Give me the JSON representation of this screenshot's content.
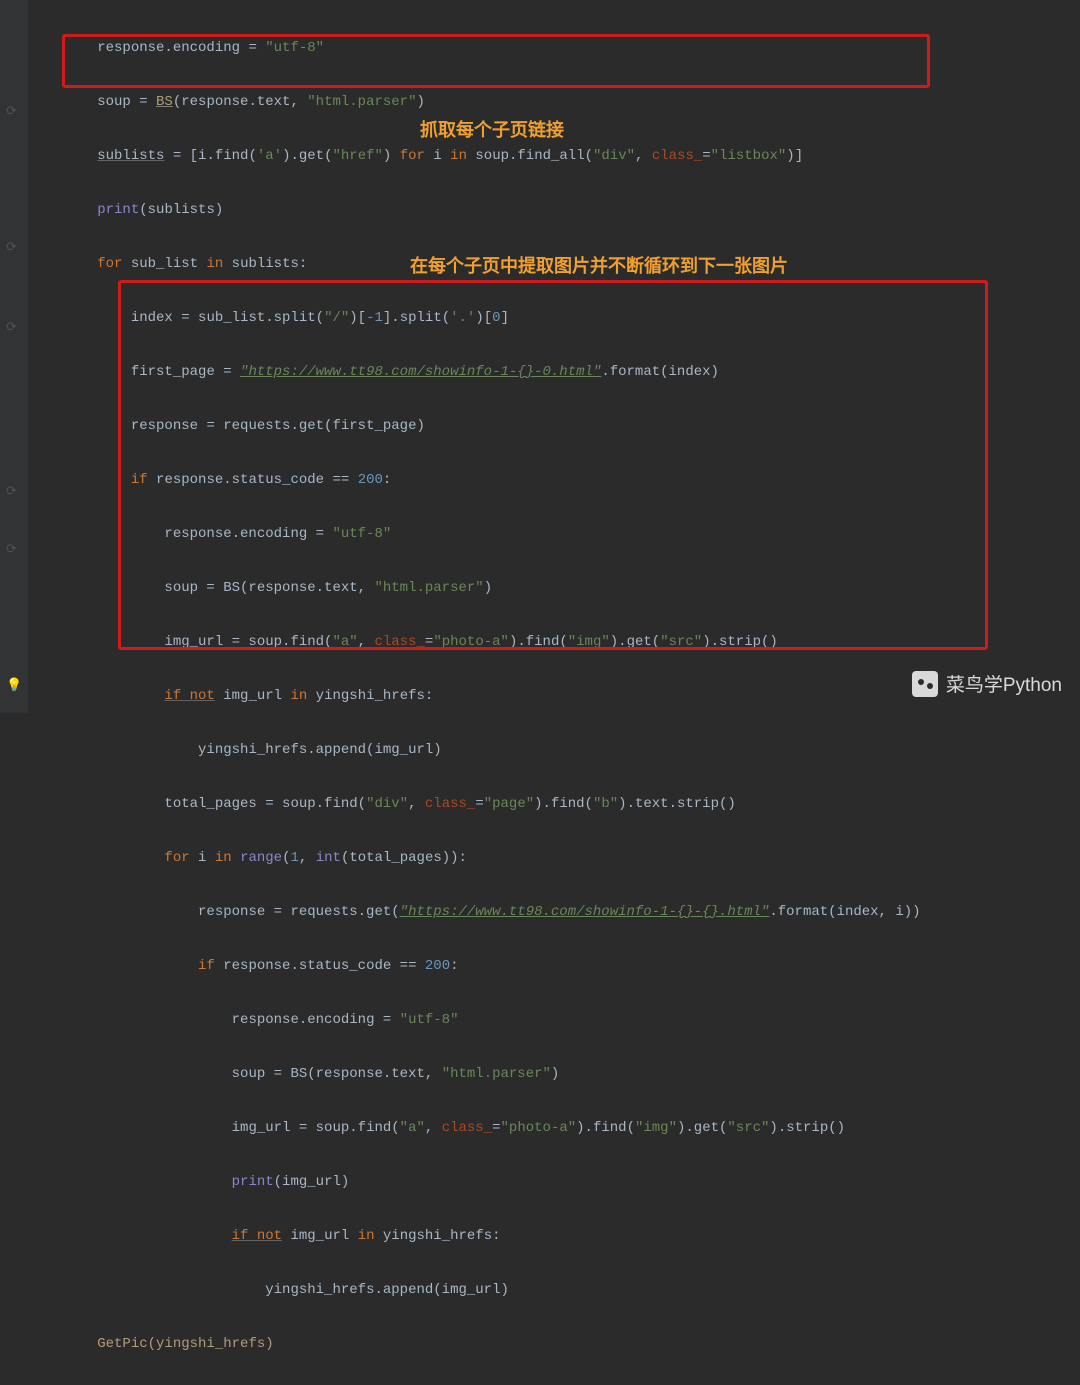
{
  "annotations": {
    "box1_label": "抓取每个子页链接",
    "box2_label": "在每个子页中提取图片并不断循环到下一张图片"
  },
  "watermark": "菜鸟学Python",
  "code": {
    "l01_a": "response.encoding = ",
    "l01_s": "\"utf-8\"",
    "l02_a": "soup = ",
    "l02_b": "BS",
    "l02_c": "(response.text, ",
    "l02_s": "\"html.parser\"",
    "l02_d": ")",
    "l03_a": "sublists",
    "l03_b": " = [i.find(",
    "l03_s1": "'a'",
    "l03_c": ").get(",
    "l03_s2": "\"href\"",
    "l03_d": ") ",
    "l03_kw1": "for",
    "l03_e": " i ",
    "l03_kw2": "in",
    "l03_f": " soup.find_all(",
    "l03_s3": "\"div\"",
    "l03_g": ", ",
    "l03_kwarg": "class_",
    "l03_h": "=",
    "l03_s4": "\"listbox\"",
    "l03_i": ")]",
    "l04_a": "print",
    "l04_b": "(sublists)",
    "l05_kw1": "for",
    "l05_a": " sub_list ",
    "l05_kw2": "in",
    "l05_b": " sublists:",
    "l06_a": "index = sub_list.split(",
    "l06_s1": "\"/\"",
    "l06_b": ")[",
    "l06_n": "-1",
    "l06_c": "].split(",
    "l06_s2": "'.'",
    "l06_d": ")[",
    "l06_n2": "0",
    "l06_e": "]",
    "l07_a": "first_page = ",
    "l07_s": "\"https://www.tt98.com/showinfo-1-{}-0.html\"",
    "l07_b": ".format(index)",
    "l08_a": "response = requests.get(first_page)",
    "l09_kw": "if",
    "l09_a": " response.status_code == ",
    "l09_n": "200",
    "l09_b": ":",
    "l10_a": "response.encoding = ",
    "l10_s": "\"utf-8\"",
    "l11_a": "soup = BS(response.text, ",
    "l11_s": "\"html.parser\"",
    "l11_b": ")",
    "l12_a": "img_url = soup.find(",
    "l12_s1": "\"a\"",
    "l12_b": ", ",
    "l12_kwarg": "class_",
    "l12_c": "=",
    "l12_s2": "\"photo-a\"",
    "l12_d": ").find(",
    "l12_s3": "\"img\"",
    "l12_e": ").get(",
    "l12_s4": "\"src\"",
    "l12_f": ").strip()",
    "l13_kw1": "if not",
    "l13_a": " img_url ",
    "l13_kw2": "in",
    "l13_b": " yingshi_hrefs:",
    "l14_a": "yingshi_hrefs.append(img_url)",
    "l15_a": "total_pages = soup.find(",
    "l15_s1": "\"div\"",
    "l15_b": ", ",
    "l15_kwarg": "class_",
    "l15_c": "=",
    "l15_s2": "\"page\"",
    "l15_d": ").find(",
    "l15_s3": "\"b\"",
    "l15_e": ").text.strip()",
    "l16_kw": "for",
    "l16_a": " i ",
    "l16_kw2": "in",
    "l16_b": " ",
    "l16_fn": "range",
    "l16_c": "(",
    "l16_n1": "1",
    "l16_d": ", ",
    "l16_fn2": "int",
    "l16_e": "(total_pages)):",
    "l17_a": "response = requests.get(",
    "l17_s": "\"https://www.tt98.com/showinfo-1-{}-{}.html\"",
    "l17_b": ".format(index, i))",
    "l18_kw": "if",
    "l18_a": " response.status_code == ",
    "l18_n": "200",
    "l18_b": ":",
    "l19_a": "response.encoding = ",
    "l19_s": "\"utf-8\"",
    "l20_a": "soup = BS(response.text, ",
    "l20_s": "\"html.parser\"",
    "l20_b": ")",
    "l21_a": "img_url = soup.find(",
    "l21_s1": "\"a\"",
    "l21_b": ", ",
    "l21_kwarg": "class_",
    "l21_c": "=",
    "l21_s2": "\"photo-a\"",
    "l21_d": ").find(",
    "l21_s3": "\"img\"",
    "l21_e": ").get(",
    "l21_s4": "\"src\"",
    "l21_f": ").strip()",
    "l22_fn": "print",
    "l22_a": "(img_url)",
    "l23_kw1": "if not",
    "l23_a": " img_url ",
    "l23_kw2": "in",
    "l23_b": " yingshi_hrefs:",
    "l24_a": "yingshi_hrefs.append(img_url)",
    "l25_a": "GetPic(yingshi_hrefs)"
  },
  "indent": {
    "i1": "        ",
    "i2": "            ",
    "i3": "                ",
    "i4": "                    ",
    "i5": "                        ",
    "i6": "                            "
  }
}
